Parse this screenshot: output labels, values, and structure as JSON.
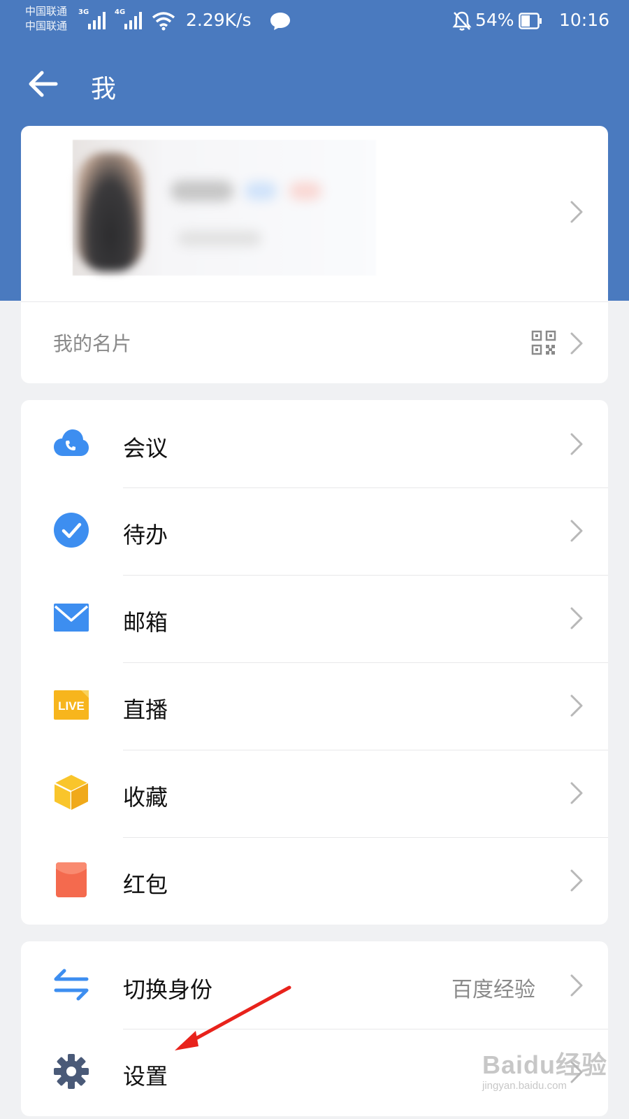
{
  "status_bar": {
    "carrier_1": "中国联通",
    "carrier_2": "中国联通",
    "network_1": "3G",
    "network_2": "4G",
    "speed": "2.29K/s",
    "battery_percent": "54%",
    "battery_level": 0.54,
    "time": "10:16"
  },
  "header": {
    "title": "我",
    "back_icon": "arrow-left-icon"
  },
  "profile": {
    "name_card_label": "我的名片",
    "qr_icon": "qr-code-icon"
  },
  "menu": {
    "items": [
      {
        "label": "会议",
        "icon": "cloud-phone-icon"
      },
      {
        "label": "待办",
        "icon": "check-circle-icon"
      },
      {
        "label": "邮箱",
        "icon": "mail-icon"
      },
      {
        "label": "直播",
        "icon": "live-icon",
        "icon_text": "LIVE"
      },
      {
        "label": "收藏",
        "icon": "cube-icon"
      },
      {
        "label": "红包",
        "icon": "red-packet-icon"
      }
    ]
  },
  "settings": {
    "switch_identity_label": "切换身份",
    "switch_identity_value": "百度经验",
    "settings_label": "设置"
  },
  "watermark": {
    "brand": "Baidu经验",
    "url": "jingyan.baidu.com"
  },
  "colors": {
    "header_blue": "#4a7abf",
    "icon_blue": "#3d8ef0",
    "live_orange": "#f7b51d",
    "cube_yellow": "#f9c52b",
    "red_packet": "#f46a4e",
    "annotation_red": "#e8221b"
  }
}
